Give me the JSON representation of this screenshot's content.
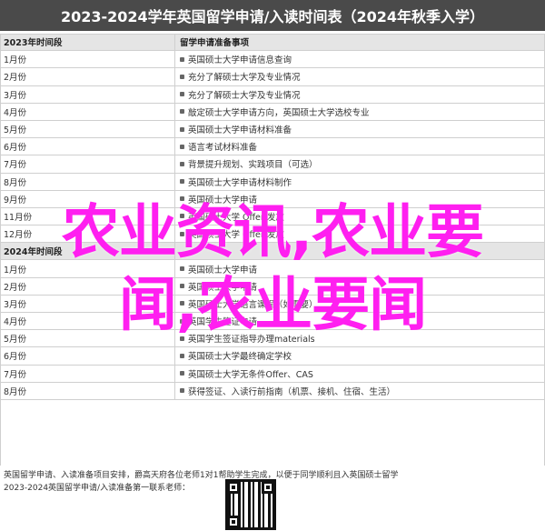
{
  "title": "2023-2024学年英国留学申请/入读时间表（2024年秋季入学）",
  "table": {
    "header": {
      "col1": "2023年时间段",
      "col2": "留学申请准备事项"
    },
    "rows_2023": [
      {
        "col1": "1月份",
        "col2": "英国硕士大学申请信息查询"
      },
      {
        "col1": "2月份",
        "col2": "充分了解硕士大学及专业情况"
      },
      {
        "col1": "3月份",
        "col2": "充分了解硕士大学及专业情况"
      },
      {
        "col1": "4月份",
        "col2": "敲定硕士大学申请方向，英国硕士大学选校专业"
      },
      {
        "col1": "5月份",
        "col2": "英国硕士大学申请材料准备"
      },
      {
        "col1": "6月份",
        "col2": "语言考试材料准备"
      },
      {
        "col1": "7月份",
        "col2": "背景提升规划、实践项目（可选）"
      },
      {
        "col1": "8月份",
        "col2": "英国硕士大学申请材料制作"
      },
      {
        "col1": "9月份",
        "col2": "英国硕士大学申请"
      },
      {
        "col1": "11月份",
        "col2": "英国硕士大学 Offer 发放"
      },
      {
        "col1": "12月份",
        "col2": "英国硕士大学 Offer 发放"
      }
    ],
    "section": {
      "col1": "2024年时间段",
      "col2": ""
    },
    "rows_2024": [
      {
        "col1": "1月份",
        "col2": "英国硕士大学申请"
      },
      {
        "col1": "2月份",
        "col2": "英国硕士大学申请"
      },
      {
        "col1": "3月份",
        "col2": "英国硕士大学语言课程（如需要）"
      },
      {
        "col1": "4月份",
        "col2": "英国学生签证申请"
      },
      {
        "col1": "5月份",
        "col2": "英国学生签证指导办理materials"
      },
      {
        "col1": "6月份",
        "col2": "英国硕士大学最终确定学校"
      },
      {
        "col1": "7月份",
        "col2": "英国硕士大学无条件Offer、CAS"
      },
      {
        "col1": "8月份",
        "col2": "获得签证、入读行前指南（机票、接机、住宿、生活）"
      }
    ]
  },
  "overlay": {
    "line1": "农业资讯,农业要",
    "line2": "闻,农业要闻"
  },
  "footer": {
    "line1": "英国留学申请、入读准备项目安排，爵高天府各位老师1对1帮助学生完成，以便于同学顺利且入英国硕士留学",
    "line2": "2023-2024英国留学申请/入读准备第一联系老师："
  },
  "colors": {
    "overlay": "#ff1ff0",
    "title_bg": "#4a4a4a"
  }
}
